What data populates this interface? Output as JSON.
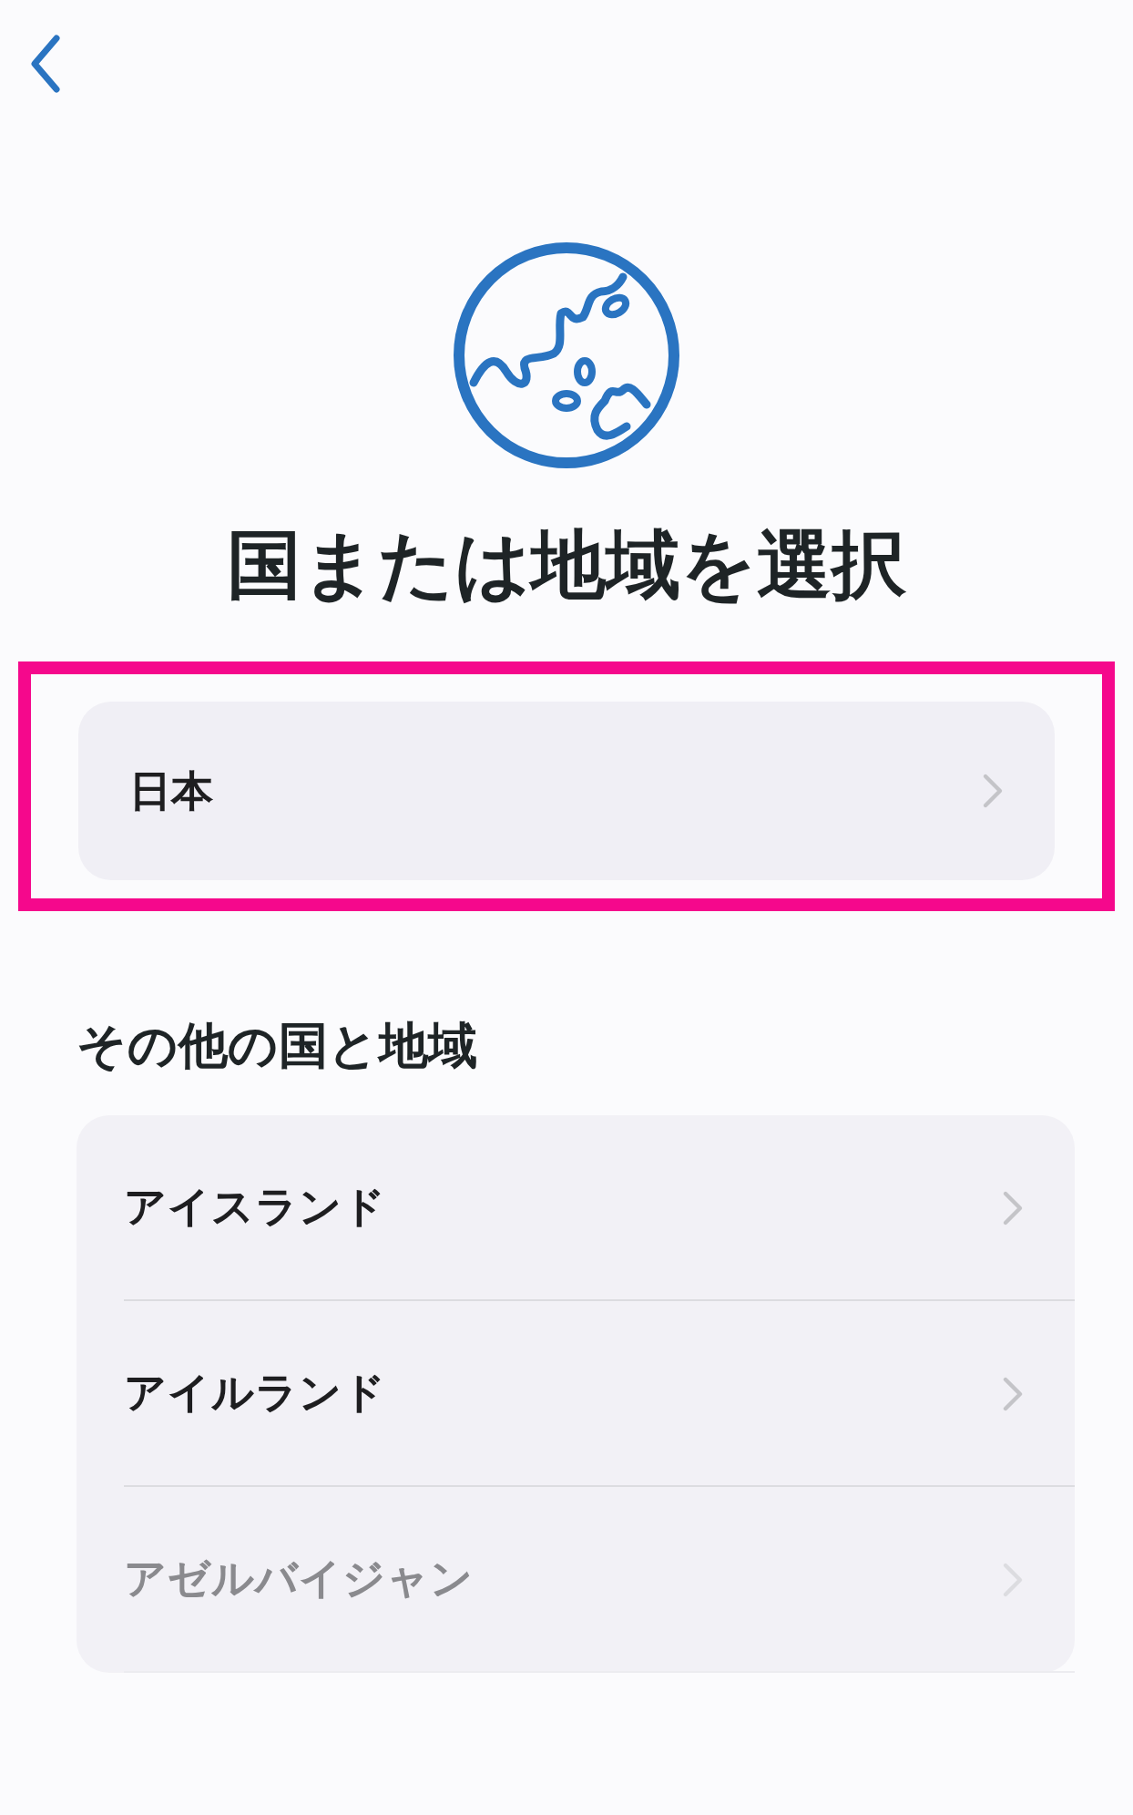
{
  "title": "国または地域を選択",
  "current": {
    "label": "日本",
    "highlighted": true
  },
  "section_title": "その他の国と地域",
  "items": [
    {
      "label": "アイスランド",
      "dimmed": false
    },
    {
      "label": "アイルランド",
      "dimmed": false
    },
    {
      "label": "アゼルバイジャン",
      "dimmed": true
    }
  ]
}
